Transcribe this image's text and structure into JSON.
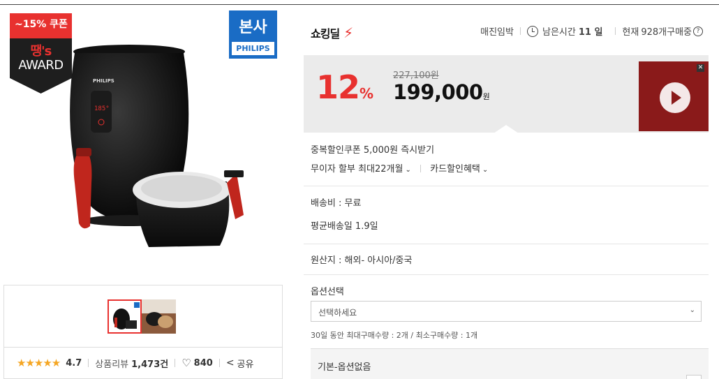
{
  "badges": {
    "coupon_discount": "~15% 쿠폰",
    "coupon_title": "땡's",
    "coupon_award": "AWARD",
    "brand_main": "본사",
    "brand_sub": "PHILIPS"
  },
  "product_image": {
    "alt": "PHILIPS"
  },
  "rating": {
    "stars": "★★★★★",
    "score": "4.7",
    "review_label": "상품리뷰",
    "review_count": "1,473건",
    "like_count": "840",
    "share_label": "공유"
  },
  "deal": {
    "logo": "쇼킹딜",
    "status": "매진임박",
    "time_label": "남은시간",
    "time_value": "11 일",
    "buyers_prefix": "현재",
    "buyers_count": "928개",
    "buyers_suffix": "구매중"
  },
  "price": {
    "discount_rate": "12",
    "discount_unit": "%",
    "original": "227,100원",
    "sale": "199,000",
    "sale_unit": "원"
  },
  "promo": {
    "close": "✕"
  },
  "benefits": {
    "coupon": "중복할인쿠폰 5,000원 즉시받기",
    "installment": "무이자 할부 최대22개월",
    "card": "카드할인혜택"
  },
  "shipping": {
    "fee": "배송비 : 무료",
    "average": "평균배송일 1.9일"
  },
  "origin": {
    "text": "원산지 : 해외- 아시아/중국"
  },
  "option": {
    "title": "옵션선택",
    "placeholder": "선택하세요",
    "limit": "30일 동안 최대구매수량 : 2개 / 최소구매수량 : 1개",
    "basic": "기본-옵션없음"
  },
  "colors": {
    "accent_red": "#e8312f",
    "brand_blue": "#1a6cc5",
    "price_bg": "#ebebeb"
  }
}
